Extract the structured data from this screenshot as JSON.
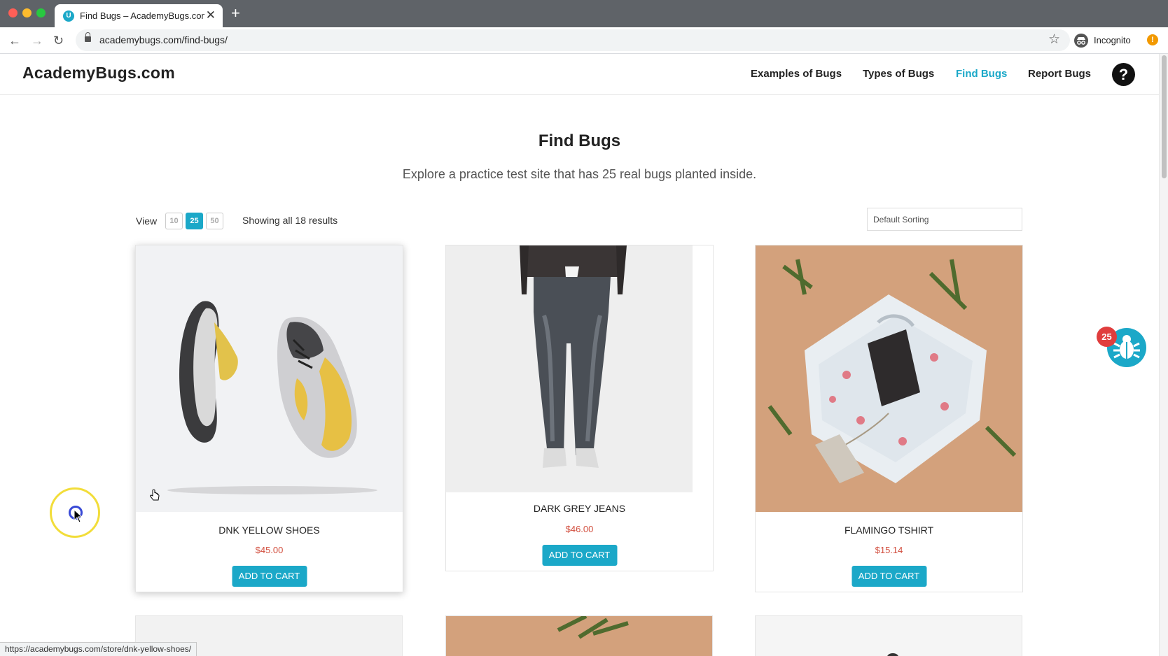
{
  "browser": {
    "tab_title": "Find Bugs – AcademyBugs.com",
    "tab_favicon_letter": "U",
    "url": "academybugs.com/find-bugs/",
    "profile_label": "Incognito",
    "status_url": "https://academybugs.com/store/dnk-yellow-shoes/"
  },
  "header": {
    "logo": "AcademyBugs.com",
    "nav": [
      {
        "label": "Examples of Bugs",
        "active": false
      },
      {
        "label": "Types of Bugs",
        "active": false
      },
      {
        "label": "Find Bugs",
        "active": true
      },
      {
        "label": "Report Bugs",
        "active": false
      }
    ],
    "help_icon_glyph": "?"
  },
  "main": {
    "title": "Find Bugs",
    "subtitle": "Explore a practice test site that has 25 real bugs planted inside.",
    "view_label": "View",
    "view_options": [
      "10",
      "25",
      "50"
    ],
    "view_selected": "25",
    "results_text": "Showing all 18 results",
    "sort_selected": "Default Sorting"
  },
  "products": [
    {
      "name": "DNK Yellow Shoes",
      "price": "$45.00",
      "button": "Add to cart",
      "image": "shoes-image"
    },
    {
      "name": "Dark Grey Jeans",
      "price": "$46.00",
      "button": "Add to cart",
      "image": "jeans-image"
    },
    {
      "name": "Flamingo Tshirt",
      "price": "$15.14",
      "button": "Add to cart",
      "image": "tshirt-image"
    }
  ],
  "bug_widget": {
    "badge_count": "25",
    "icon": "bug-icon"
  },
  "colors": {
    "accent": "#1ba8c8",
    "price": "#d24f3f",
    "badge": "#e03d3d",
    "chrome": "#5f6368"
  }
}
